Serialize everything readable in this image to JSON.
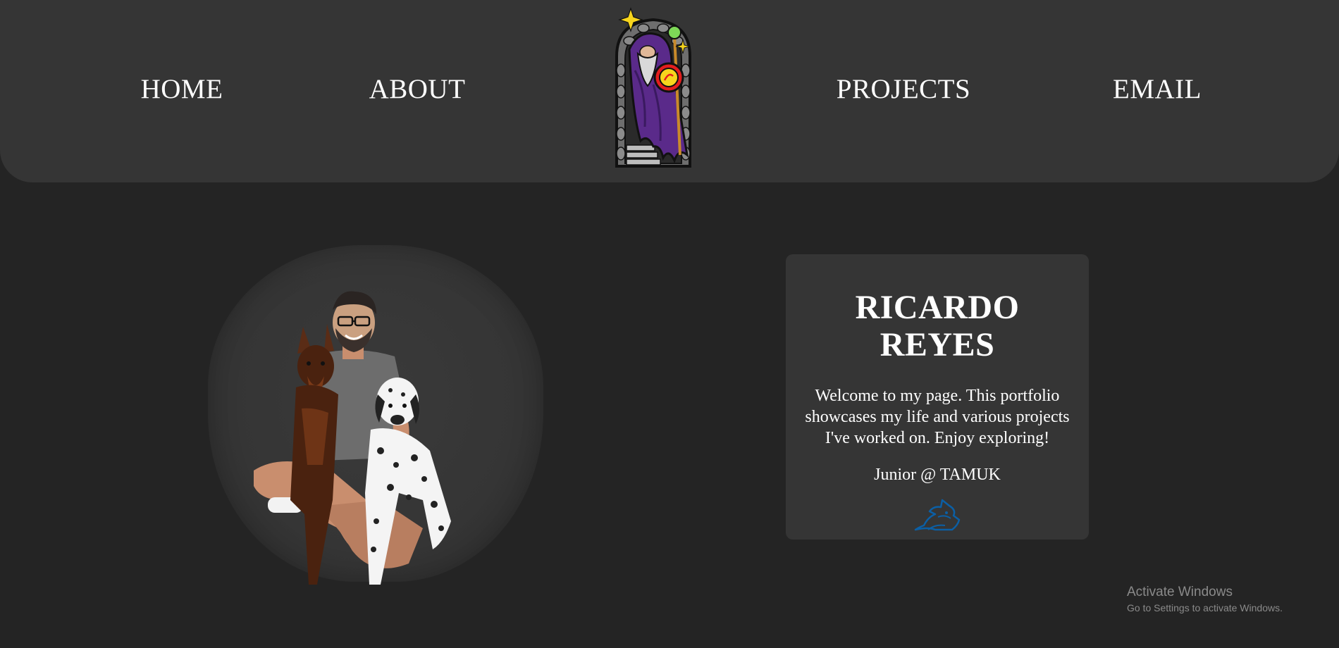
{
  "nav": {
    "home": "HOME",
    "about": "ABOUT",
    "projects": "PROJECTS",
    "email": "EMAIL"
  },
  "logo": {
    "icon": "wizard-logo-icon"
  },
  "hero": {
    "photo_icon": "portrait-with-dogs-image"
  },
  "card": {
    "title": "RICARDO REYES",
    "description": "Welcome to my page. This portfolio showcases my life and various projects I've worked on. Enjoy exploring!",
    "subtitle": "Junior @ TAMUK",
    "mascot_icon": "javelina-mascot-icon"
  },
  "watermark": {
    "title": "Activate Windows",
    "subtitle": "Go to Settings to activate Windows."
  },
  "colors": {
    "background": "#242424",
    "panel": "#353535",
    "text": "#ffffff",
    "mascot_blue": "#0b5fa5",
    "wizard_purple": "#5a2a8a"
  }
}
